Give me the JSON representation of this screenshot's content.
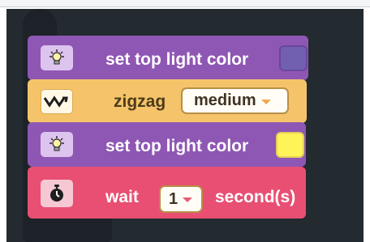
{
  "blocks": [
    {
      "label": "set top light color",
      "icon": "light-bulb-icon",
      "color_value": "#7160b0"
    },
    {
      "label": "zigzag",
      "icon": "zigzag-icon",
      "dropdown_value": "medium"
    },
    {
      "label": "set top light color",
      "icon": "light-bulb-icon",
      "color_value": "#fff35a"
    },
    {
      "label": "wait",
      "icon": "stopwatch-icon",
      "dropdown_value": "1",
      "suffix": "second(s)"
    }
  ],
  "colors": {
    "light_block": "#8f57b4",
    "move_block": "#f5c46a",
    "control_block": "#e84f73",
    "workspace": "#232a30"
  }
}
